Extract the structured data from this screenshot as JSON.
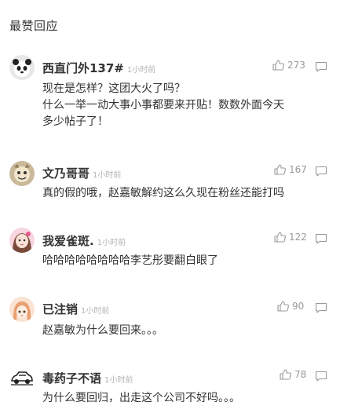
{
  "section_title": "最赞回应",
  "comments": [
    {
      "username": "西直门外137#",
      "time": "1小时前",
      "likes": "273",
      "lines": [
        "现在是怎样？这团大火了吗？",
        "什么一举一动大事小事都要来开贴！数数外面今天",
        "多少帖子了！"
      ],
      "avatar_icon": "panda-avatar-icon"
    },
    {
      "username": "文乃哥哥",
      "time": "1小时前",
      "likes": "167",
      "lines": [
        "真的假的哦，赵嘉敏解约这么久现在粉丝还能打吗"
      ],
      "avatar_icon": "cartoon-avatar-icon"
    },
    {
      "username": "我爱雀斑.",
      "time": "1小时前",
      "likes": "122",
      "lines": [
        "哈哈哈哈哈哈哈哈李艺彤要翻白眼了"
      ],
      "avatar_icon": "girl-avatar-icon"
    },
    {
      "username": "已注销",
      "time": "1小时前",
      "likes": "90",
      "lines": [
        "赵嘉敏为什么要回来。。。"
      ],
      "avatar_icon": "anime-avatar-icon"
    },
    {
      "username": "毒药子不语",
      "time": "1小时前",
      "likes": "78",
      "lines": [
        "为什么要回归，出走这个公司不好吗。。。"
      ],
      "avatar_icon": "car-avatar-icon"
    }
  ],
  "colors": {
    "text": "#333333",
    "muted": "#999999",
    "time": "#b3b3b3"
  }
}
